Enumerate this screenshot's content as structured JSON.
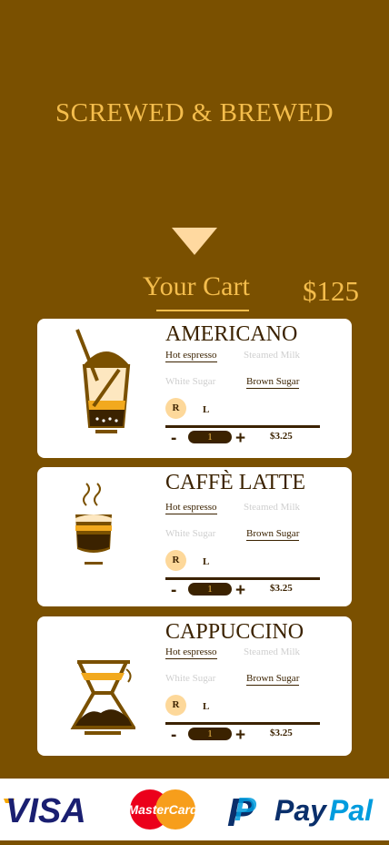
{
  "header": {
    "brand": "SCREWED & BREWED"
  },
  "cart": {
    "title": "Your Cart",
    "total": "$125"
  },
  "items": [
    {
      "name": "AMERICANO",
      "base_selected": "Hot espresso",
      "base_other": "Steamed Milk",
      "sugar_other": "White Sugar",
      "sugar_selected": "Brown Sugar",
      "size_selected": "R",
      "size_other": "L",
      "qty": "1",
      "price": "$3.25",
      "minus": "-",
      "plus": "+"
    },
    {
      "name": "CAFFÈ LATTE",
      "base_selected": "Hot espresso",
      "base_other": "Steamed Milk",
      "sugar_other": "White Sugar",
      "sugar_selected": "Brown Sugar",
      "size_selected": "R",
      "size_other": "L",
      "qty": "1",
      "price": "$3.25",
      "minus": "-",
      "plus": "+"
    },
    {
      "name": "CAPPUCCINO",
      "base_selected": "Hot espresso",
      "base_other": "Steamed Milk",
      "sugar_other": "White Sugar",
      "sugar_selected": "Brown Sugar",
      "size_selected": "R",
      "size_other": "L",
      "qty": "1",
      "price": "$3.25",
      "minus": "-",
      "plus": "+"
    }
  ],
  "payments": {
    "visa": "VISA",
    "mastercard": "MasterCard",
    "paypal_pay": "Pay",
    "paypal_pal": "Pal"
  },
  "colors": {
    "background": "#7a5000",
    "accent": "#f4bd4c",
    "dark": "#3b2200",
    "highlight": "#fdd89a"
  }
}
